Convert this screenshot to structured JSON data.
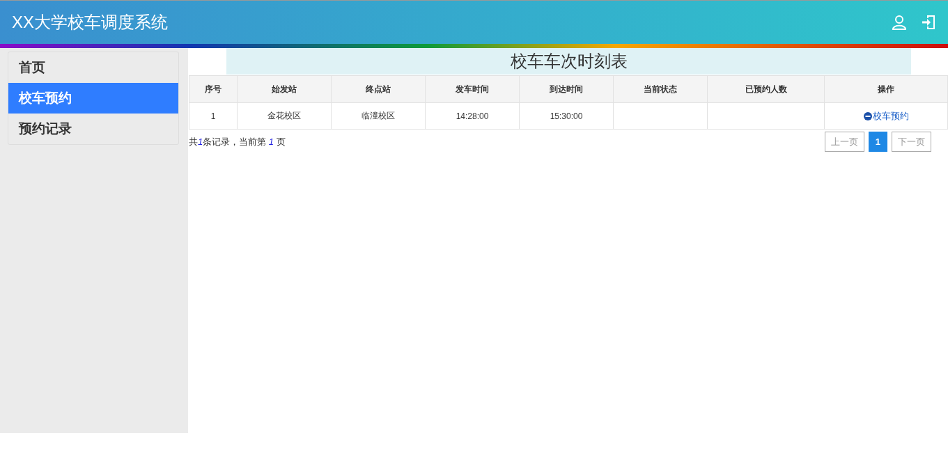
{
  "header": {
    "title": "XX大学校车调度系统"
  },
  "sidebar": {
    "items": [
      {
        "label": "首页",
        "selected": false
      },
      {
        "label": "校车预约",
        "selected": true
      },
      {
        "label": "预约记录",
        "selected": false
      }
    ]
  },
  "page_title": "校车车次时刻表",
  "table": {
    "columns": [
      "序号",
      "始发站",
      "终点站",
      "发车时间",
      "到达时间",
      "当前状态",
      "已预约人数",
      "操作"
    ],
    "rows": [
      {
        "cells": [
          "1",
          "金花校区",
          "临潼校区",
          "14:28:00",
          "15:30:00"
        ],
        "action": "校车预约"
      }
    ]
  },
  "pagination": {
    "summary": {
      "before": "共",
      "total": "1",
      "middle": "条记录，当前第 ",
      "current": "1",
      "after": " 页"
    },
    "prev": "上一页",
    "pages": [
      {
        "label": "1",
        "selected": true
      }
    ],
    "next": "下一页"
  }
}
